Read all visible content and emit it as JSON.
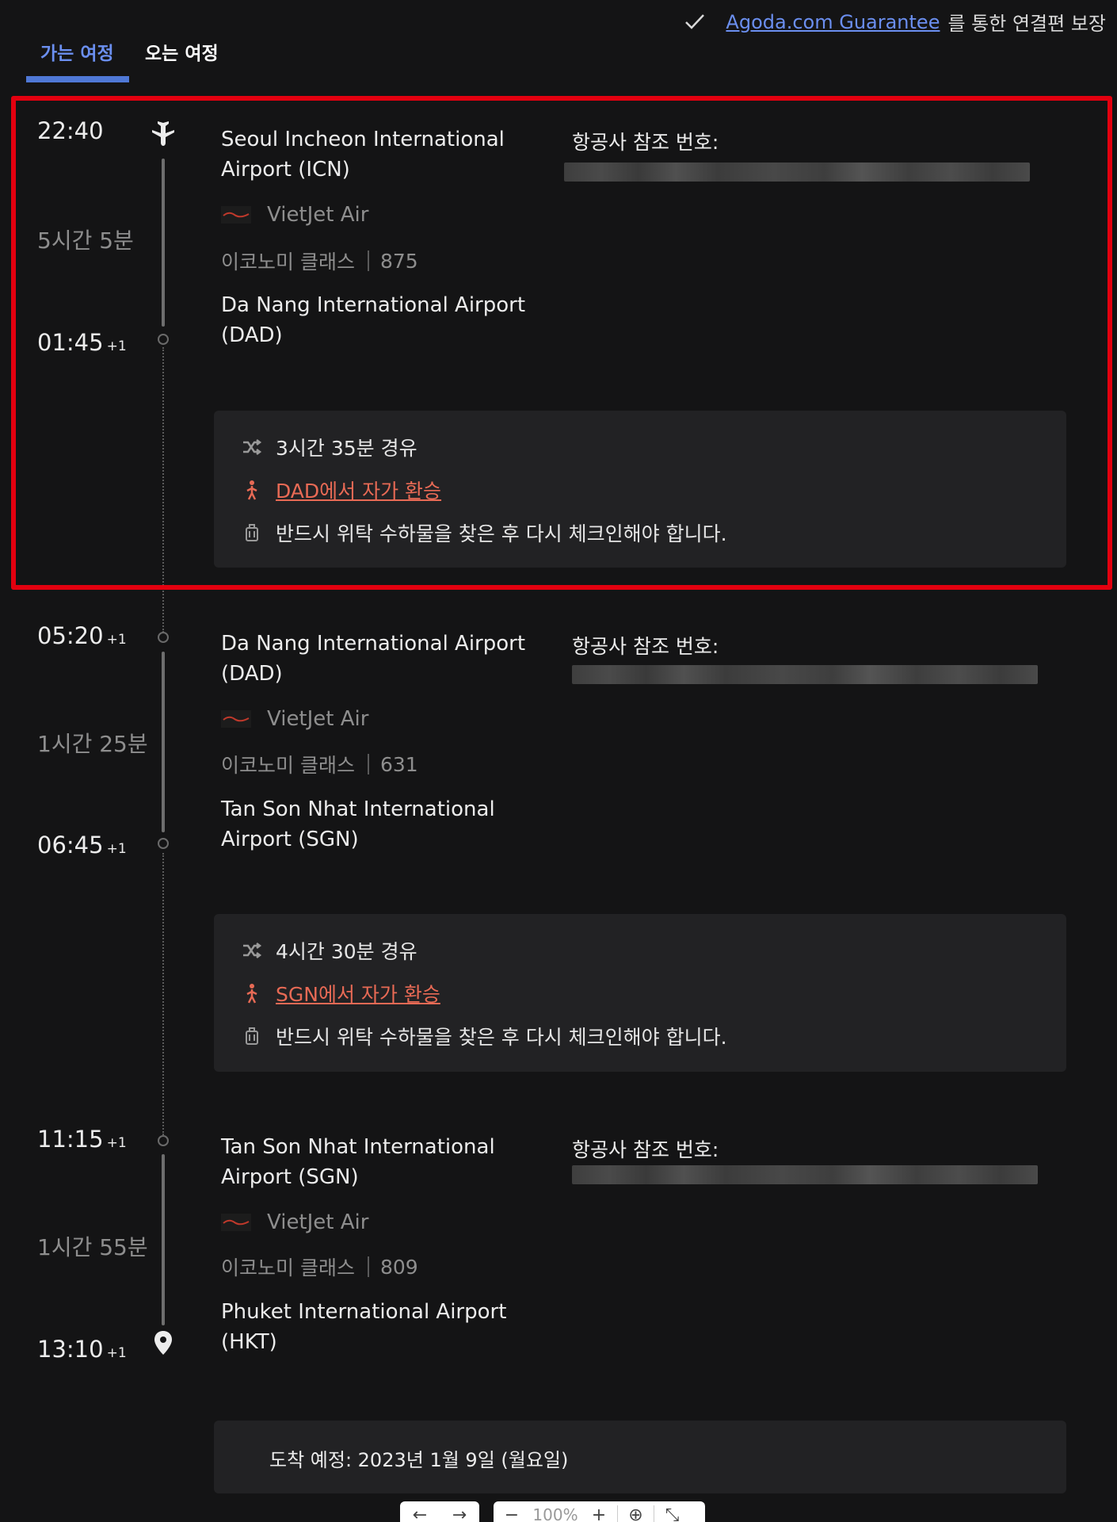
{
  "header": {
    "guarantee_link": "Agoda.com Guarantee",
    "guarantee_suffix": "를 통한 연결편 보장"
  },
  "tabs": [
    {
      "label": "가는 여정",
      "active": true
    },
    {
      "label": "오는 여정",
      "active": false
    }
  ],
  "ref_label": "항공사 참조 번호:",
  "segments": [
    {
      "depart_time": "22:40",
      "depart_plus": "",
      "duration": "5시간 5분",
      "arrive_time": "01:45",
      "arrive_plus": "+1",
      "from": "Seoul Incheon International Airport (ICN)",
      "airline": "VietJet Air",
      "cabin": "이코노미 클래스",
      "flight_no": "875",
      "to": "Da Nang International Airport (DAD)"
    },
    {
      "depart_time": "05:20",
      "depart_plus": "+1",
      "duration": "1시간 25분",
      "arrive_time": "06:45",
      "arrive_plus": "+1",
      "from": "Da Nang International Airport (DAD)",
      "airline": "VietJet Air",
      "cabin": "이코노미 클래스",
      "flight_no": "631",
      "to": "Tan Son Nhat International Airport (SGN)"
    },
    {
      "depart_time": "11:15",
      "depart_plus": "+1",
      "duration": "1시간 55분",
      "arrive_time": "13:10",
      "arrive_plus": "+1",
      "from": "Tan Son Nhat International Airport (SGN)",
      "airline": "VietJet Air",
      "cabin": "이코노미 클래스",
      "flight_no": "809",
      "to": "Phuket International Airport (HKT)"
    }
  ],
  "layovers": [
    {
      "stop": "3시간 35분 경유",
      "self_transfer": "DAD에서 자가 환승",
      "baggage": "반드시 위탁 수하물을 찾은 후 다시 체크인해야 합니다."
    },
    {
      "stop": "4시간 30분 경유",
      "self_transfer": "SGN에서 자가 환승",
      "baggage": "반드시 위탁 수하물을 찾은 후 다시 체크인해야 합니다."
    }
  ],
  "arrival": "도착 예정: 2023년 1월 9일 (월요일)",
  "viewer": {
    "zoom": "100%"
  },
  "colors": {
    "accent": "#6b8ff0",
    "warning": "#e86a55",
    "highlight": "#e3000f"
  }
}
